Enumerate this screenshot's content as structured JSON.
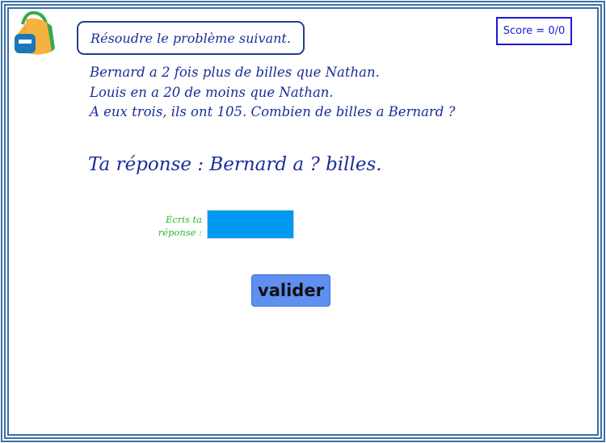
{
  "header": {
    "instruction": "Résoudre le problème suivant.",
    "score_label": "Score = 0/0",
    "icon": "backpack-icon"
  },
  "problem": {
    "lines": [
      "Bernard a 2 fois plus de billes que Nathan.",
      "Louis en a 20 de moins que Nathan.",
      "A eux trois, ils ont 105. Combien de billes a Bernard ?"
    ]
  },
  "answer": {
    "prompt": "Ta réponse : Bernard a ? billes.",
    "label_line1": "Écris ta",
    "label_line2": "réponse :",
    "input_value": ""
  },
  "actions": {
    "submit_label": "valider"
  },
  "colors": {
    "text_blue": "#1a2d99",
    "border_blue": "#3a6ea5",
    "input_blue": "#0098f0",
    "button_blue": "#5f8ff0",
    "label_green": "#2fb52f"
  }
}
